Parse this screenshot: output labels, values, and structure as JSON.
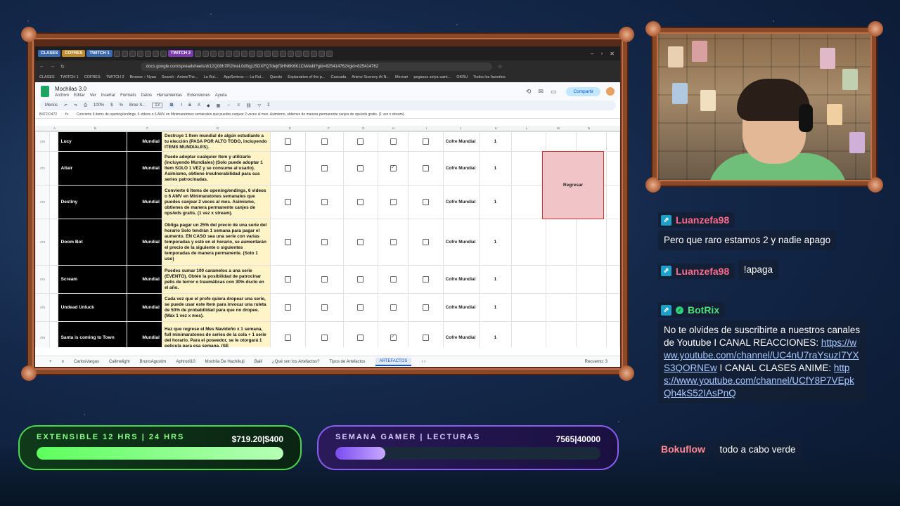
{
  "browser": {
    "tab_groups": [
      "CLASES",
      "COFRES",
      "TWITCH 1",
      "TWITCH 2"
    ],
    "url": "docs.google.com/spreadsheets/d/12Q08h7Pl2hreL0d0qjUSDXFQ7dejrf3HN6K6K1CM/edit?gid=825414762#gid=825414762",
    "bookmarks": [
      "CLASES",
      "TWITCH 1",
      "COFRES",
      "TWITCH 2",
      "Browse :: Nyaa",
      "Search - AnimeThe...",
      "La Rul...",
      "AppSorteos — La Rul...",
      "Quests",
      "Explanation of the p...",
      "Cascada",
      "Anime Scenery At N...",
      "Mercari",
      "pegasus seiya saint...",
      "OKRU",
      "Todos los favoritos"
    ]
  },
  "sheet": {
    "title": "Mochilas 3.0",
    "menu": [
      "Archivo",
      "Editar",
      "Ver",
      "Insertar",
      "Formato",
      "Datos",
      "Herramientas",
      "Extensiones",
      "Ayuda"
    ],
    "share_label": "Compartir",
    "toolbar": {
      "menus": "Menús",
      "zoom": "100%",
      "font": "Bree S...",
      "font_size": "13"
    },
    "cell_ref": "B472:D472",
    "formula_text": "Convierte 6 items de opening/endings, 6 videos o 6 AMV en Minimaratones semanales que puedes canjear 2 veces al mes. Asimismo, obtienes de manera permanente canjes de ops/eds gratis. (1 vez x stream).",
    "columns": [
      "A",
      "B",
      "C",
      "D",
      "E",
      "F",
      "G",
      "H",
      "I",
      "J",
      "K",
      "L",
      "M",
      "N"
    ],
    "rows": [
      {
        "num": "470",
        "name": "Lucy",
        "type": "Mundial",
        "desc": "Destruye 1 Item mundial de algún estudiante a tu elección (PASA POR ALTO TODO, incluyendo ITEMS MUNDIALES).",
        "checks": [
          false,
          false,
          false,
          false,
          false
        ],
        "prize": "Cofre Mundial",
        "qty": "1"
      },
      {
        "num": "471",
        "name": "Altair",
        "type": "Mundial",
        "desc": "Puede adoptar cualquier Item y utilizarlo (incluyendo Mundiales) (Solo puede adoptar 1 Item SOLO 1 VEZ y se consume al usarlo). Asimismo, obtiene invulnerabilidad para sus series patrocinadas.",
        "checks": [
          false,
          false,
          false,
          true,
          false
        ],
        "prize": "Cofre Mundial",
        "qty": "1"
      },
      {
        "num": "472",
        "name": "Destiny",
        "type": "Mundial",
        "desc": "Convierte 6 Items de opening/endings, 6 videos o 6 AMV en Minimaratones semanales que puedes canjear 2 veces al mes. Asimismo, obtienes de manera permanente canjes de ops/eds gratis. (1 vez x stream).",
        "checks": [
          false,
          false,
          false,
          false,
          false
        ],
        "prize": "Cofre Mundial",
        "qty": "1"
      },
      {
        "num": "473",
        "name": "Doom Bot",
        "type": "Mundial",
        "desc": "Obliga pagar un 25% del precio de una serie del horario Solo tendrán 1 semana para pagar el aumento. EN CASO sea una serie con varias temporadas y esté en el horario, se aumentarán el precio de la siguiente o siguientes temporadas de manera permanente. (Solo 1 uso)",
        "checks": [
          false,
          false,
          false,
          false,
          false
        ],
        "prize": "Cofre Mundial",
        "qty": "1"
      },
      {
        "num": "474",
        "name": "Scream",
        "type": "Mundial",
        "desc": "Puedes sumar 100 caramelos a una serie (EVENTO). Obtén la posibilidad de patrocinar pelis de terror o traumáticas con 30% dscto en el año.",
        "checks": [
          false,
          false,
          false,
          false,
          false
        ],
        "prize": "Cofre Mundial",
        "qty": "1"
      },
      {
        "num": "475",
        "name": "Undead Unluck",
        "type": "Mundial",
        "desc": "Cada vez que el profe quiera dropear una serie, se puede usar este Item para invocar una ruleta de 50% de probabilidad para que no dropee. (Máx 1 vez x mes).",
        "checks": [
          false,
          false,
          false,
          false,
          false
        ],
        "prize": "Cofre Mundial",
        "qty": "1"
      },
      {
        "num": "476",
        "name": "Santa is coming to Town",
        "type": "Mundial",
        "desc": "Haz que regrese el Mes Navideño x 1 semana, full minimaratones de series de la cola + 1 serie del horario. Para el poseedor, se le otorgará 1 película para esa semana. (SE",
        "checks": [
          false,
          false,
          false,
          true,
          false
        ],
        "prize": "Cofre Mundial",
        "qty": "1"
      }
    ],
    "regresar_label": "Regresar",
    "tabs": [
      "CarlosVargas",
      "Callmelight",
      "BrunoAgustim",
      "Aphrodi10",
      "Mochila De Hachikuji",
      "Baiil",
      "¿Qué son los Artefactos?",
      "Tipos de Artefactos",
      "ARTEFACTOS"
    ],
    "recuento": "Recuento: 3"
  },
  "chat": [
    {
      "user": "Luanzefa98",
      "color": "#ff6a8a",
      "text": "Pero que raro estamos 2 y nadie apago"
    },
    {
      "user": "Luanzefa98",
      "color": "#ff6a8a",
      "text": "!apaga"
    },
    {
      "user": "BotRix",
      "color": "#4de07a",
      "pre": "No te olvides de suscribirte a nuestros canales de Youtube I CANAL REACCIONES:",
      "link1": "https://www.youtube.com/channel/UC4nU7raYsuzI7YXS3QORNEw",
      "mid": "I CANAL CLASES ANIME:",
      "link2": "https://www.youtube.com/channel/UCfY8P7VEpkQh4kS52IAsPnQ"
    },
    {
      "user": "Bokuflow",
      "color": "#ff8a9a",
      "text": "todo a cabo verde"
    }
  ],
  "goals": [
    {
      "label": "EXTENSIBLE 12 HRS | 24 HRS",
      "value": "$719.20|$400",
      "progress": 1.0,
      "color": "#6dff6d"
    },
    {
      "label": "SEMANA GAMER | LECTURAS",
      "value": "7565|40000",
      "progress": 0.189,
      "color": "#9d6cff"
    }
  ]
}
